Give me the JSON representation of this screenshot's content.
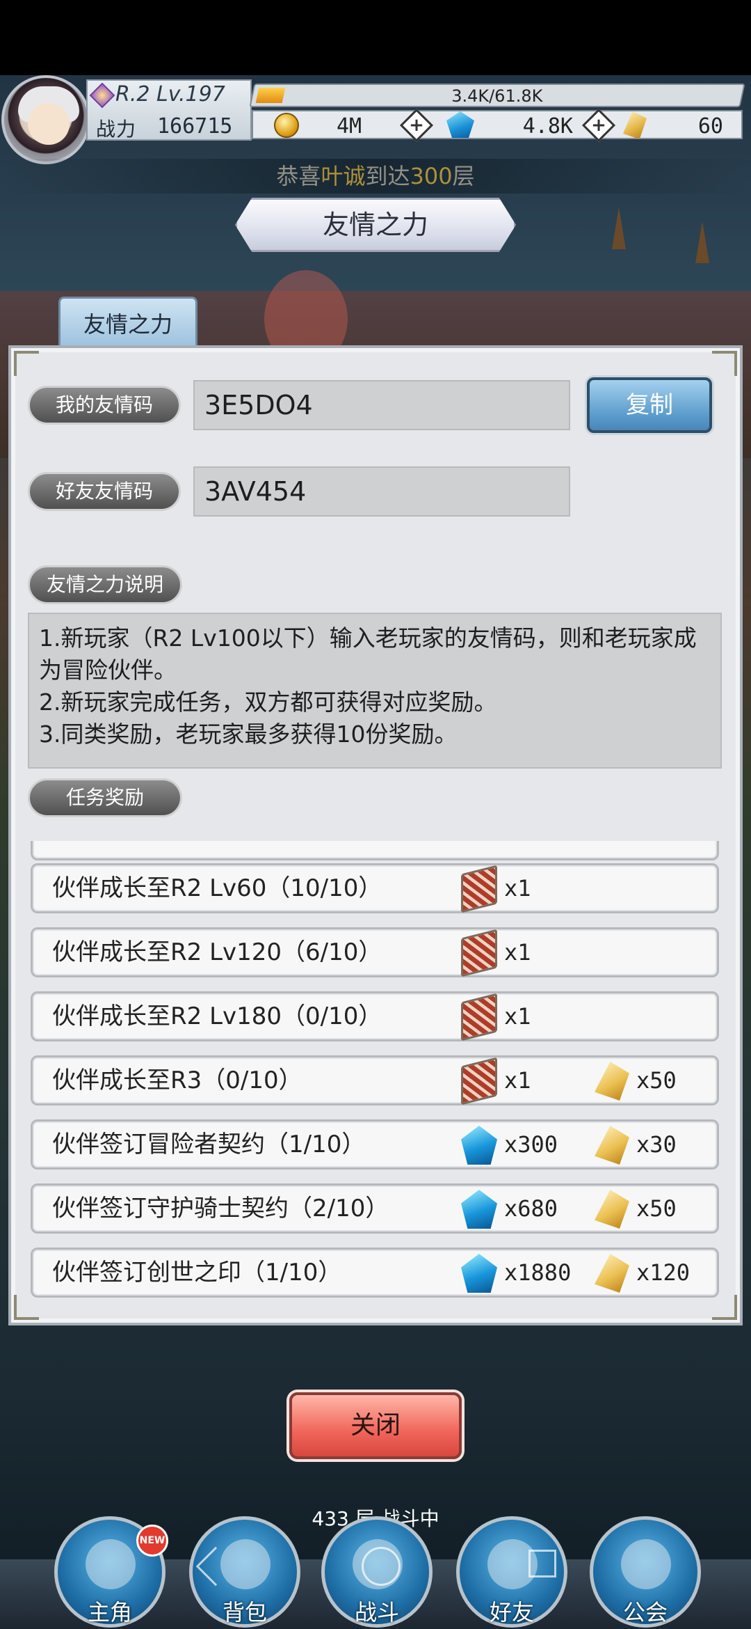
{
  "hud": {
    "rank": "R.2 Lv.197",
    "power_label": "战力",
    "power_value": "166715",
    "exp_text": "3.4K/61.8K",
    "exp_fraction": 0.055,
    "coin": "4M",
    "gem": "4.8K",
    "crystal": "60",
    "plus_symbol": "+"
  },
  "notice": {
    "prefix": "恭喜",
    "name": "叶诚",
    "middle": "到达",
    "floor": "300",
    "suffix": "层"
  },
  "title": "友情之力",
  "tab_label": "友情之力",
  "codes": {
    "my_label": "我的友情码",
    "my_value": "3E5DO4",
    "friend_label": "好友友情码",
    "friend_value": "3AV454",
    "copy_label": "复制"
  },
  "description": {
    "label": "友情之力说明",
    "lines": [
      "1.新玩家（R2 Lv100以下）输入老玩家的友情码，则和老玩家成为冒险伙伴。",
      "2.新玩家完成任务，双方都可获得对应奖励。",
      "3.同类奖励，老玩家最多获得10份奖励。"
    ]
  },
  "tasks": {
    "label": "任务奖励",
    "rows": [
      {
        "name": "伙伴成长至R2 Lv60（10/10）",
        "r1_icon": "book-icon",
        "r1_qty": "x1",
        "r2_icon": "",
        "r2_qty": ""
      },
      {
        "name": "伙伴成长至R2 Lv120（6/10）",
        "r1_icon": "book-icon",
        "r1_qty": "x1",
        "r2_icon": "",
        "r2_qty": ""
      },
      {
        "name": "伙伴成长至R2 Lv180（0/10）",
        "r1_icon": "book-icon",
        "r1_qty": "x1",
        "r2_icon": "",
        "r2_qty": ""
      },
      {
        "name": "伙伴成长至R3（0/10）",
        "r1_icon": "book-icon",
        "r1_qty": "x1",
        "r2_icon": "crystal-icon",
        "r2_qty": "x50"
      },
      {
        "name": "伙伴签订冒险者契约（1/10）",
        "r1_icon": "gem-icon",
        "r1_qty": "x300",
        "r2_icon": "crystal-icon",
        "r2_qty": "x30"
      },
      {
        "name": "伙伴签订守护骑士契约（2/10）",
        "r1_icon": "gem-icon",
        "r1_qty": "x680",
        "r2_icon": "crystal-icon",
        "r2_qty": "x50"
      },
      {
        "name": "伙伴签订创世之印（1/10）",
        "r1_icon": "gem-icon",
        "r1_qty": "x1880",
        "r2_icon": "crystal-icon",
        "r2_qty": "x120"
      }
    ]
  },
  "close_label": "关闭",
  "floor_status": "433 层 战斗中",
  "nav": {
    "items": [
      {
        "label": "主角",
        "icon": "hero-icon"
      },
      {
        "label": "背包",
        "icon": "bag-icon"
      },
      {
        "label": "战斗",
        "icon": "battle-icon"
      },
      {
        "label": "好友",
        "icon": "friends-icon"
      },
      {
        "label": "公会",
        "icon": "guild-icon"
      }
    ],
    "new_badge": "NEW"
  },
  "colors": {
    "accent_blue": "#5b9ccd",
    "close_red": "#f0655a",
    "panel_bg": "#e6e7ea",
    "notice_highlight": "#dcb43c"
  }
}
